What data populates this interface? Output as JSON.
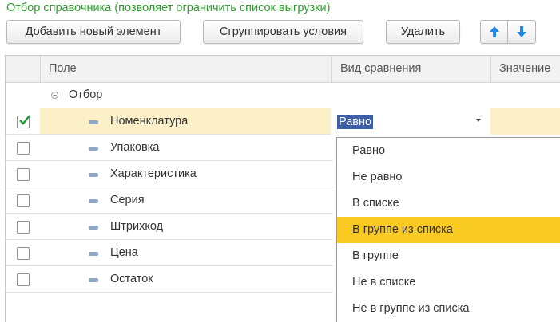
{
  "section": {
    "title": "Отбор справочника (позволяет ограничить список выгрузки)"
  },
  "toolbar": {
    "add_label": "Добавить новый элемент",
    "group_label": "Сгруппировать условия",
    "delete_label": "Удалить",
    "move_up_icon": "arrow-up-icon",
    "move_down_icon": "arrow-down-icon"
  },
  "grid": {
    "columns": {
      "field": "Поле",
      "comparison": "Вид сравнения",
      "value": "Значение"
    },
    "group": {
      "label": "Отбор",
      "expanded": true
    },
    "rows": [
      {
        "label": "Номенклатура",
        "checked": true,
        "comparison": "Равно",
        "selected": true
      },
      {
        "label": "Упаковка",
        "checked": false
      },
      {
        "label": "Характеристика",
        "checked": false
      },
      {
        "label": "Серия",
        "checked": false
      },
      {
        "label": "Штрихкод",
        "checked": false
      },
      {
        "label": "Цена",
        "checked": false
      },
      {
        "label": "Остаток",
        "checked": false
      }
    ]
  },
  "dropdown": {
    "options": [
      "Равно",
      "Не равно",
      "В списке",
      "В группе из списка",
      "В группе",
      "Не в списке",
      "Не в группе из списка"
    ],
    "highlighted_index": 3
  },
  "colors": {
    "title_green": "#2a9d2a",
    "selected_row": "#fbf0c8",
    "highlight": "#f9cb22",
    "checkmark": "#1f9c3a",
    "arrow_blue": "#1e88e5"
  }
}
